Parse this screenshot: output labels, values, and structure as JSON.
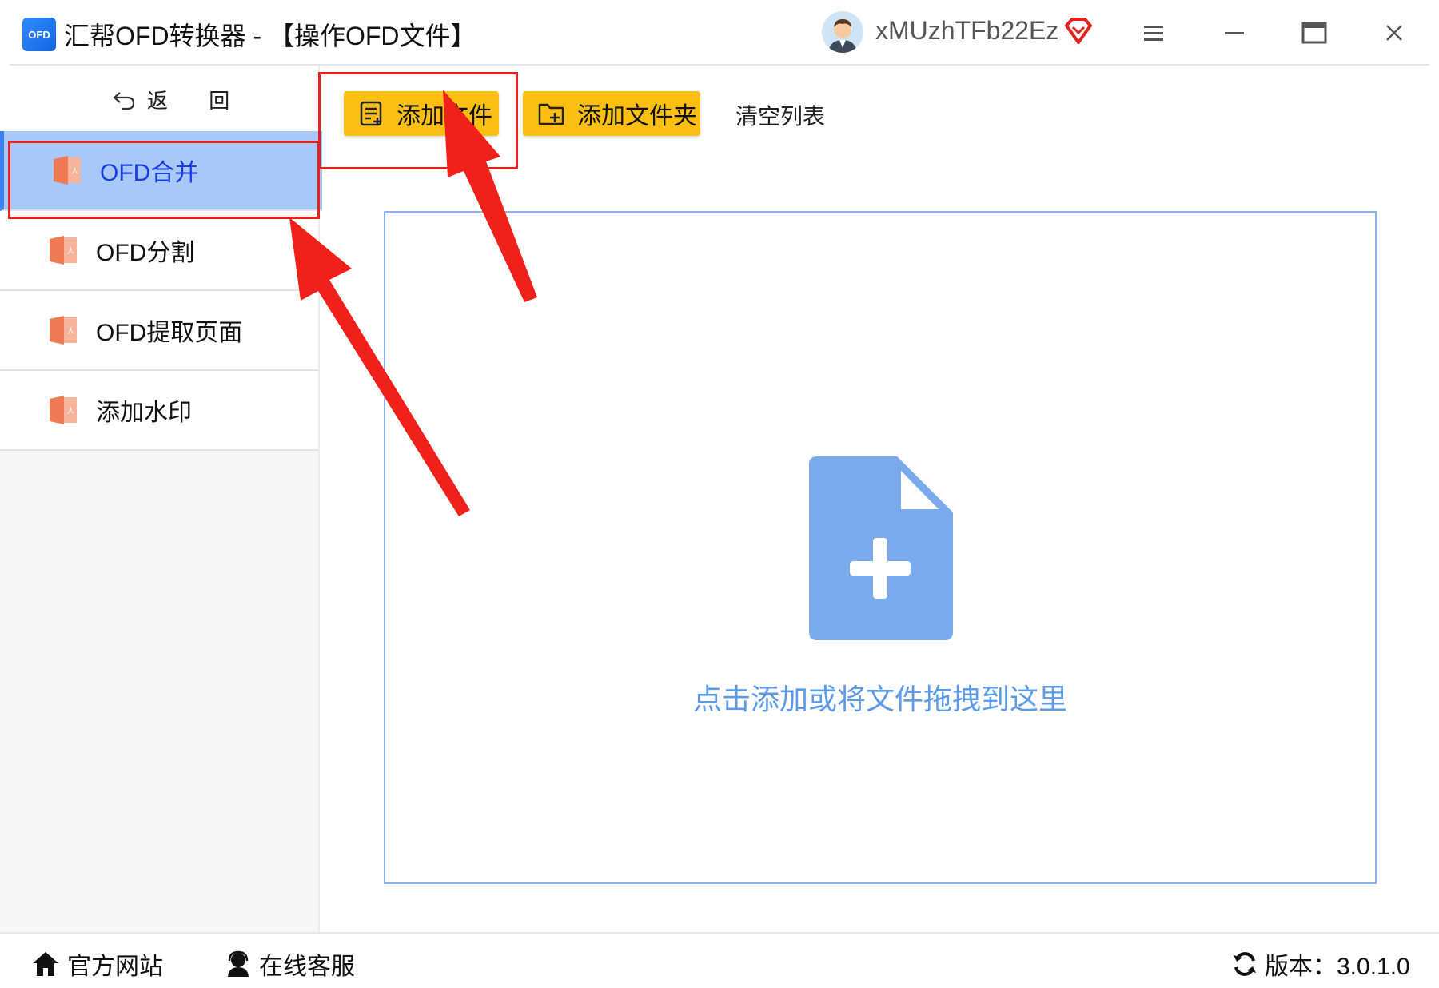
{
  "window": {
    "logo_text": "OFD",
    "title": "汇帮OFD转换器 - 【操作OFD文件】",
    "username": "xMUzhTFb22Ez"
  },
  "sidebar": {
    "back_label": "返 回",
    "items": [
      {
        "label": "OFD合并",
        "active": true
      },
      {
        "label": "OFD分割",
        "active": false
      },
      {
        "label": "OFD提取页面",
        "active": false
      },
      {
        "label": "添加水印",
        "active": false
      }
    ]
  },
  "toolbar": {
    "add_file": "添加文件",
    "add_folder": "添加文件夹",
    "clear_list": "清空列表"
  },
  "dropzone": {
    "hint": "点击添加或将文件拖拽到这里"
  },
  "footer": {
    "website": "官方网站",
    "support": "在线客服",
    "version": "版本：3.0.1.0"
  },
  "colors": {
    "accent_yellow": "#fbbf14",
    "active_nav": "#a8c8f7",
    "drop_blue": "#7aa9ec",
    "callout_red": "#e42222"
  }
}
